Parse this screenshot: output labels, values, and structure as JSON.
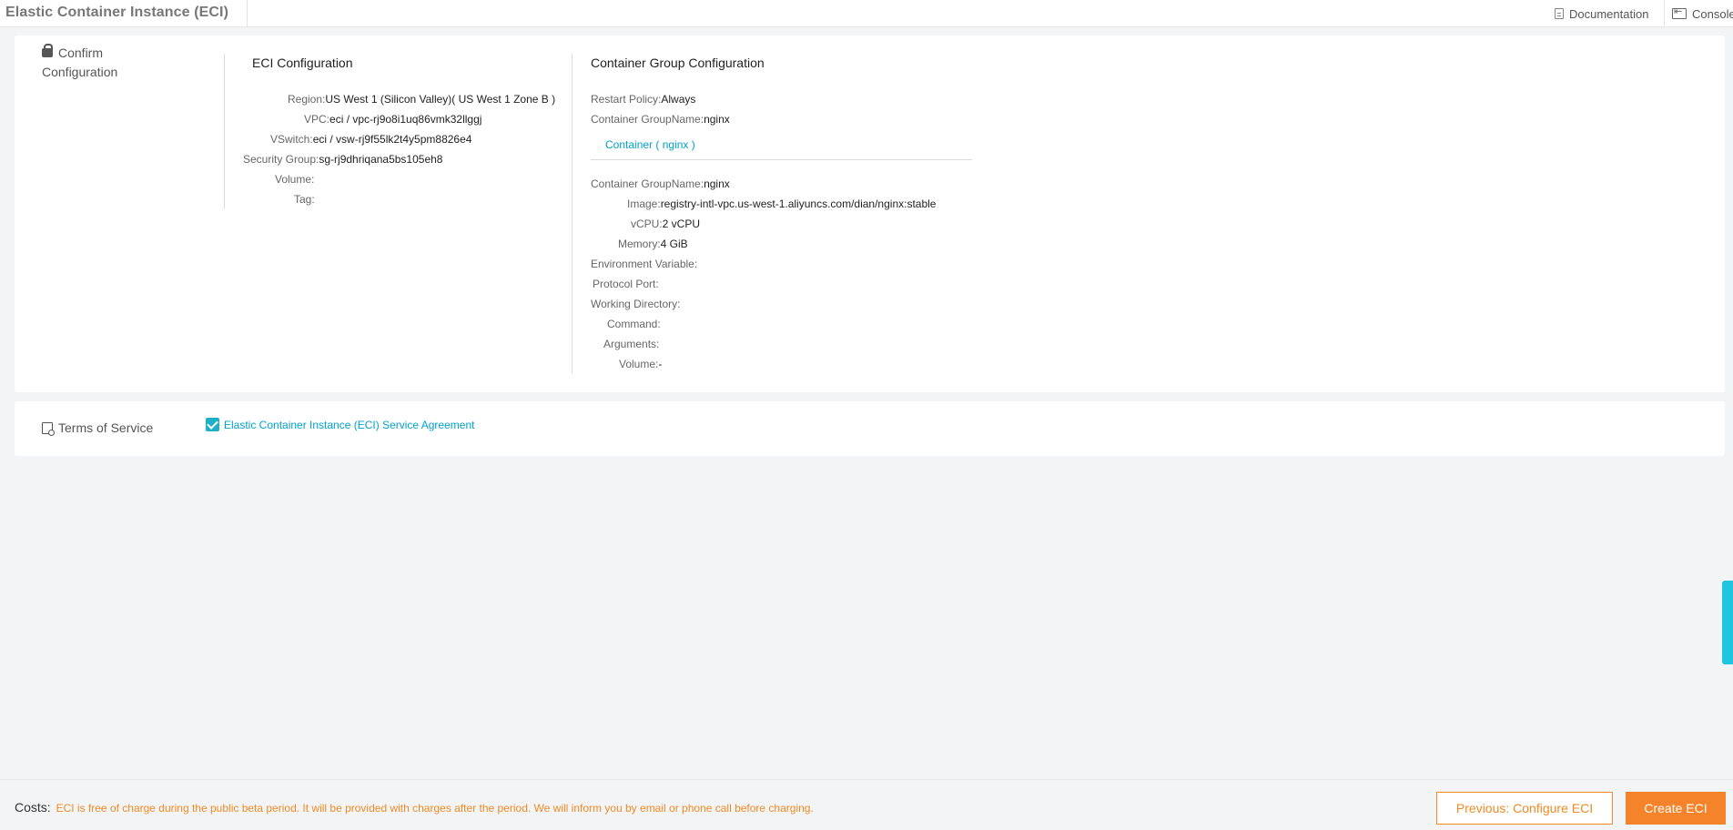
{
  "header": {
    "title": "Elastic Container Instance (ECI)",
    "documentation_label": "Documentation",
    "console_label": "Console"
  },
  "confirm": {
    "heading_line1": "Confirm",
    "heading_line2": "Configuration",
    "eci": {
      "title": "ECI Configuration",
      "rows": [
        {
          "label": "Region:",
          "value": "US West 1 (Silicon Valley)( US West 1 Zone B )"
        },
        {
          "label": "VPC:",
          "value": "eci / vpc-rj9o8i1uq86vmk32llggj"
        },
        {
          "label": "VSwitch:",
          "value": "eci / vsw-rj9f55lk2t4y5pm8826e4"
        },
        {
          "label": "Security Group:",
          "value": "sg-rj9dhriqana5bs105eh8"
        },
        {
          "label": "Volume:",
          "value": ""
        },
        {
          "label": "Tag:",
          "value": ""
        }
      ]
    },
    "group": {
      "title": "Container Group Configuration",
      "restart_label": "Restart Policy:",
      "restart_value": "Always",
      "group_name_label": "Container GroupName:",
      "group_name_value": "nginx",
      "container_tab": "Container ( nginx )",
      "container_rows": [
        {
          "label": "Container GroupName:",
          "value": "nginx"
        },
        {
          "label": "Image:",
          "value": "registry-intl-vpc.us-west-1.aliyuncs.com/dian/nginx:stable"
        },
        {
          "label": "vCPU:",
          "value": "2 vCPU"
        },
        {
          "label": "Memory:",
          "value": "4 GiB"
        },
        {
          "label": "Environment Variable:",
          "value": ""
        },
        {
          "label": "Protocol Port:",
          "value": ""
        },
        {
          "label": "Working Directory:",
          "value": ""
        },
        {
          "label": "Command:",
          "value": ""
        },
        {
          "label": "Arguments:",
          "value": ""
        },
        {
          "label": "Volume:",
          "value": "-"
        }
      ]
    }
  },
  "terms": {
    "heading": "Terms of Service",
    "agreement": "Elastic Container Instance (ECI) Service Agreement",
    "checked": true
  },
  "footer": {
    "costs_label": "Costs:",
    "costs_note": "ECI is free of charge during the public beta period. It will be provided with charges after the period. We will inform you by email or phone call before charging.",
    "prev_button": "Previous: Configure ECI",
    "create_button": "Create ECI"
  },
  "colors": {
    "accent": "#00a2ca",
    "orange": "#f08a24",
    "checkbox": "#1fb0c9"
  }
}
